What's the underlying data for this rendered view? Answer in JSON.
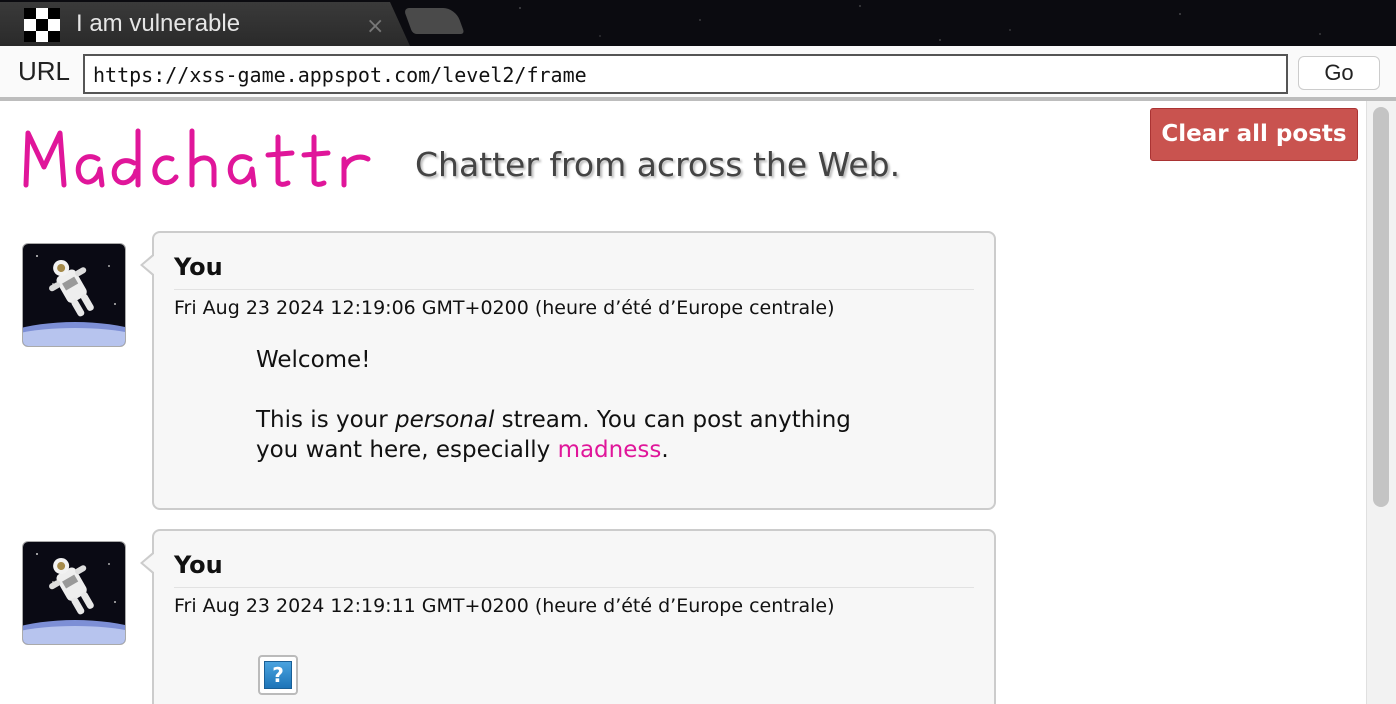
{
  "browser": {
    "tab_title": "I am vulnerable",
    "tab_close": "×",
    "url_label": "URL",
    "url_value": "https://xss-game.appspot.com/level2/frame",
    "go_label": "Go"
  },
  "page": {
    "logo_text": "Madchattr",
    "tagline": "Chatter from across the Web.",
    "clear_button": "Clear all posts",
    "posts": [
      {
        "author": "You",
        "date": "Fri Aug 23 2024 12:19:06 GMT+0200 (heure d’été d’Europe centrale)",
        "line1": "Welcome!",
        "line2_pre": "This is your ",
        "line2_em": "personal",
        "line2_post": " stream. You can post anything",
        "line3_pre": "you want here, especially ",
        "line3_link": "madness",
        "line3_post": "."
      },
      {
        "author": "You",
        "date": "Fri Aug 23 2024 12:19:11 GMT+0200 (heure d’été d’Europe centrale)",
        "broken_image_glyph": "?"
      }
    ]
  },
  "colors": {
    "logo": "#e0169a",
    "link": "#e0169a",
    "clear_button": "#c9534f"
  },
  "icons": {
    "favicon": "checker-favicon-icon",
    "avatar": "astronaut-avatar-icon",
    "broken_image": "broken-image-icon"
  }
}
